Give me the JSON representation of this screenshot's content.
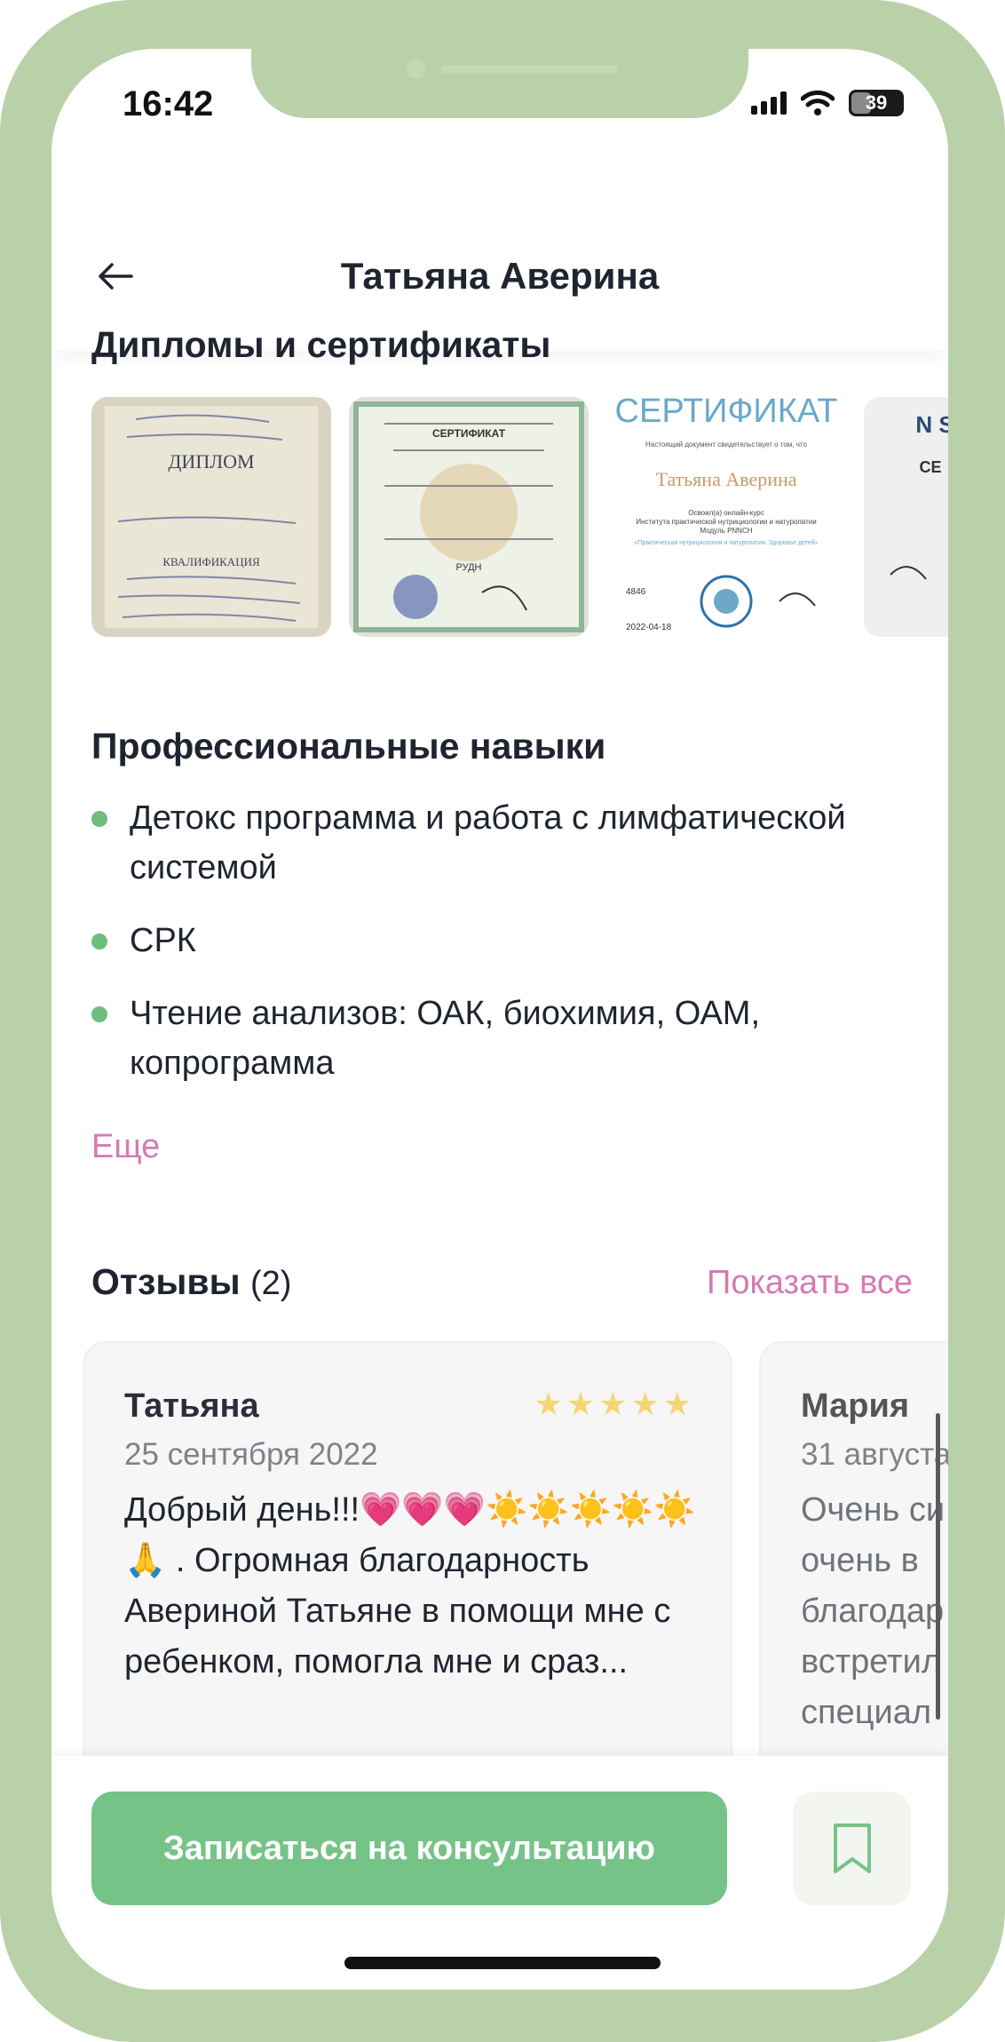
{
  "status_bar": {
    "time": "16:42",
    "battery": "39"
  },
  "header": {
    "title": "Татьяна Аверина"
  },
  "certificates": {
    "title": "Дипломы и сертификаты",
    "items": [
      {
        "heading": "ДИПЛОМ",
        "subheading": "КВАЛИФИКАЦИЯ"
      },
      {
        "heading": "СЕРТИФИКАТ",
        "subheading": "РУДН"
      },
      {
        "heading": "СЕРТИФИКАТ",
        "name": "Татьяна Аверина",
        "line1": "Настоящий документ свидетельствует о том, что",
        "line2": "Освоил(а) онлайн-курс",
        "line3": "Института практической нутрициологии и натуропатии",
        "line4": "Модуль PNNCH",
        "line5": "«Практическая нутрициология и натуропатия. Здоровье детей»",
        "number": "4846",
        "date": "2022-04-18"
      },
      {
        "heading": "N S",
        "subheading": "CE"
      }
    ]
  },
  "skills": {
    "title": "Профессиональные навыки",
    "items": [
      "Детокс программа и работа с лимфатической системой",
      "СРК",
      "Чтение анализов: ОАК, биохимия, ОАМ, копрограмма"
    ],
    "more_label": "Еще"
  },
  "reviews": {
    "title": "Отзывы",
    "count": "(2)",
    "show_all_label": "Показать все",
    "items": [
      {
        "author": "Татьяна",
        "date": "25 сентября 2022",
        "rating": 5,
        "stars": "★★★★★",
        "text": "Добрый день!!!💗💗💗☀️☀️☀️☀️☀️🙏 . Огромная благодарность Авериной Татьяне в помощи мне с ребенком, помогла мне и сраз..."
      },
      {
        "author": "Мария",
        "date": "31 августа",
        "text": "Очень си очень в благодар встретил специал"
      }
    ]
  },
  "actions": {
    "book_label": "Записаться на консультацию"
  },
  "colors": {
    "accent_green": "#76c388",
    "accent_pink": "#d67ab4",
    "frame": "#b9d1a9"
  }
}
